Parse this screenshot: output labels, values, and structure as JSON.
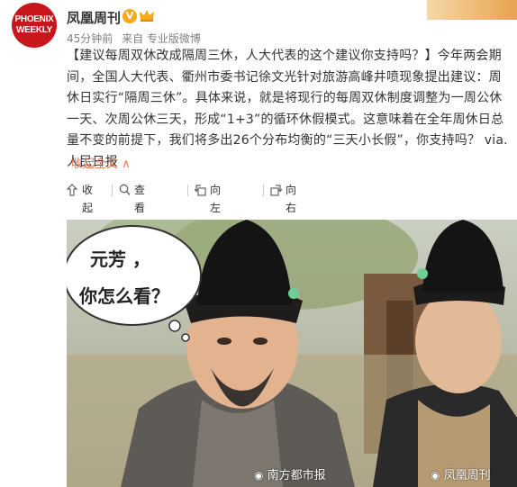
{
  "account": {
    "avatar_line1": "PHOENIX",
    "avatar_line2": "WEEKLY",
    "name": "凤凰周刊",
    "verified_mark": "V",
    "time": "45分钟前",
    "source": "来自 专业版微博"
  },
  "post": {
    "text": "【建议每周双休改成隔周三休，人大代表的这个建议你支持吗？】今年两会期间，全国人大代表、衢州市委书记徐文光针对旅游高峰井喷现象提出建议：周休日实行“隔周三休”。具体来说，就是将现行的每周双休制度调整为一周公休一天、次周公休三天，形成“1+3”的循环休假模式。这意味着在全年周休日总量不变的前提下，我们将多出26个分布均衡的“三天小长假”，你支持吗？ via.人民日报",
    "collapse_label": "收起全文 ∧"
  },
  "toolbar": {
    "collapse": "收起",
    "view_large": "查看大图",
    "rotate_left": "向左旋转",
    "rotate_right": "向右旋转"
  },
  "image": {
    "bubble_line1": "元芳 ，",
    "bubble_line2": "你怎么看？",
    "watermark_left": "南方都市报",
    "watermark_right": "凤凰周刊"
  },
  "icons": {
    "collapse": "collapse-arrow-icon",
    "zoom": "magnifier-icon",
    "rotate_left": "rotate-left-icon",
    "rotate_right": "rotate-right-icon"
  },
  "colors": {
    "accent": "#eb7350",
    "brand_red": "#c8161d",
    "verified": "#f7a81b",
    "meta_gray": "#808080"
  }
}
